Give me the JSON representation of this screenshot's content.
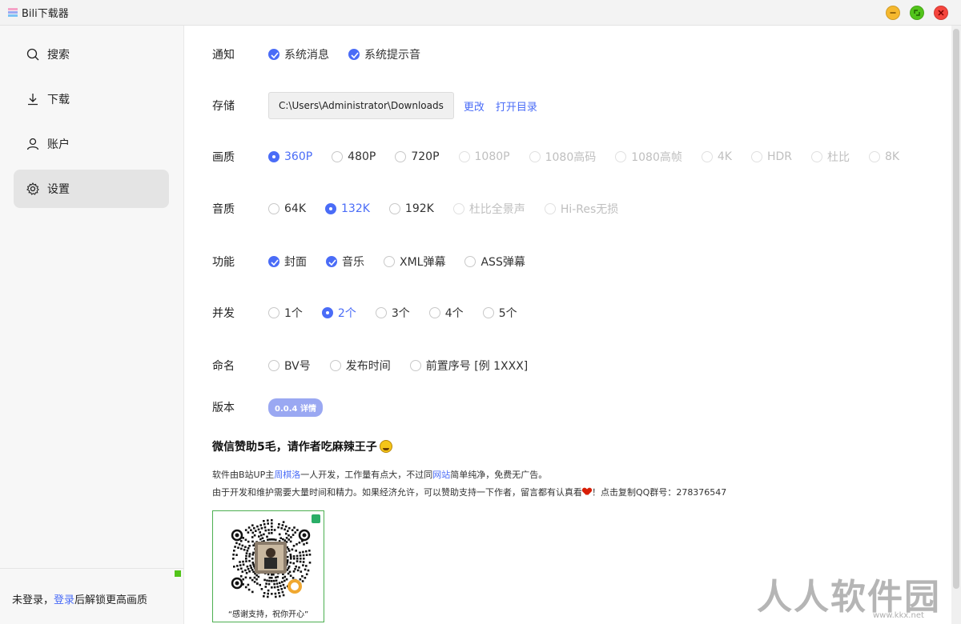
{
  "window": {
    "title": "Bili下载器"
  },
  "sidebar": {
    "items": [
      {
        "label": "搜索",
        "icon": "search-icon"
      },
      {
        "label": "下载",
        "icon": "download-icon"
      },
      {
        "label": "账户",
        "icon": "user-icon"
      },
      {
        "label": "设置",
        "icon": "gear-icon",
        "active": true
      }
    ],
    "login": {
      "prefix": "未登录，",
      "link": "登录",
      "suffix": "后解锁更高画质"
    }
  },
  "settings": {
    "notify": {
      "label": "通知",
      "options": [
        "系统消息",
        "系统提示音"
      ],
      "checked": [
        true,
        true
      ]
    },
    "storage": {
      "label": "存储",
      "path": "C:\\Users\\Administrator\\Downloads",
      "change": "更改",
      "open": "打开目录"
    },
    "quality": {
      "label": "画质",
      "options": [
        "360P",
        "480P",
        "720P",
        "1080P",
        "1080高码",
        "1080高帧",
        "4K",
        "HDR",
        "杜比",
        "8K"
      ],
      "selected": 0,
      "enabled_count": 3
    },
    "audio": {
      "label": "音质",
      "options": [
        "64K",
        "132K",
        "192K",
        "杜比全景声",
        "Hi-Res无损"
      ],
      "selected": 1,
      "enabled_count": 3
    },
    "features": {
      "label": "功能",
      "options": [
        "封面",
        "音乐",
        "XML弹幕",
        "ASS弹幕"
      ],
      "checked": [
        true,
        true,
        false,
        false
      ]
    },
    "concurrency": {
      "label": "并发",
      "options": [
        "1个",
        "2个",
        "3个",
        "4个",
        "5个"
      ],
      "selected": 1
    },
    "naming": {
      "label": "命名",
      "options": [
        "BV号",
        "发布时间",
        "前置序号 [例 1XXX]"
      ]
    },
    "version": {
      "label": "版本",
      "value": "0.0.4 详情"
    }
  },
  "donate": {
    "title": "微信赞助5毛，请作者吃麻辣王子",
    "line1": {
      "a": "软件由B站UP主",
      "author": "周棋洛",
      "b": "一人开发，工作量有点大，不过同",
      "site": "网站",
      "c": "简单纯净，免费无广告。"
    },
    "line2": {
      "a": "由于开发和维护需要大量时间和精力。如果经济允许，可以赞助支持一下作者，留言都有认真看",
      "b": "！点击复制QQ群号：278376547"
    },
    "qr_caption": "“感谢支持，祝你开心”"
  },
  "watermark": {
    "text": "人人软件园",
    "url": "www.kkx.net"
  },
  "colors": {
    "accent": "#4a6cf7",
    "minimize": "#f5b82e",
    "maximize": "#52c41a",
    "close": "#f5453d"
  }
}
